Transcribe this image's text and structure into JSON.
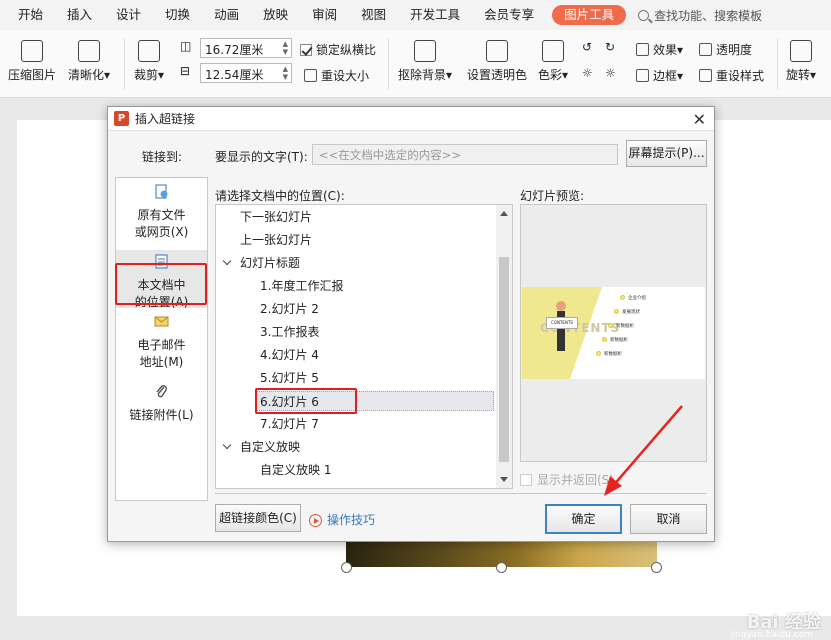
{
  "ribbon": {
    "tabs": [
      "开始",
      "插入",
      "设计",
      "切换",
      "动画",
      "放映",
      "审阅",
      "视图",
      "开发工具",
      "会员专享"
    ],
    "active_tab": "图片工具",
    "search_text": "查找功能、搜索模板",
    "accent_color": "#ef6b49"
  },
  "toolbar": {
    "compress": "压缩图片",
    "sharpen": "清晰化",
    "crop": "裁剪",
    "width_value": "16.72厘米",
    "height_value": "12.54厘米",
    "lock_ratio": "锁定纵横比",
    "reset_size": "重设大小",
    "remove_bg": "抠除背景",
    "set_transparent": "设置透明色",
    "color": "色彩",
    "effects": "效果",
    "transparency": "透明度",
    "border": "边框",
    "reset_style": "重设样式",
    "rotate": "旋转"
  },
  "dialog": {
    "title": "插入超链接",
    "link_to_label": "链接到:",
    "display_text_label": "要显示的文字(T):",
    "display_text_value": "<<在文档中选定的内容>>",
    "screen_tip_button": "屏幕提示(P)...",
    "location_label": "请选择文档中的位置(C):",
    "preview_label": "幻灯片预览:",
    "link_options": [
      {
        "line1": "原有文件",
        "line2": "或网页(X)"
      },
      {
        "line1": "本文档中",
        "line2": "的位置(A)"
      },
      {
        "line1": "电子邮件",
        "line2": "地址(M)"
      },
      {
        "line1": "链接附件(L)",
        "line2": ""
      }
    ],
    "tree": {
      "next_slide": "下一张幻灯片",
      "prev_slide": "上一张幻灯片",
      "titles_group": "幻灯片标题",
      "slides": [
        "1.年度工作汇报",
        "2.幻灯片 2",
        "3.工作报表",
        "4.幻灯片 4",
        "5.幻灯片 5",
        "6.幻灯片 6",
        "7.幻灯片 7"
      ],
      "custom_group": "自定义放映",
      "custom_items": [
        "自定义放映 1"
      ]
    },
    "show_and_return": "显示并返回(S)",
    "link_color_button": "超链接颜色(C)",
    "tips_link": "操作技巧",
    "ok_button": "确定",
    "cancel_button": "取消"
  },
  "thumbnail": {
    "bg_word": "CONTENTS",
    "sign": "CONTENTS",
    "toc": [
      "企业介绍",
      "发展现状",
      "新数据析",
      "新数据析",
      "新数据析"
    ]
  },
  "watermark": {
    "brand": "Bai 经验",
    "url": "jingyan.baidu.com"
  }
}
